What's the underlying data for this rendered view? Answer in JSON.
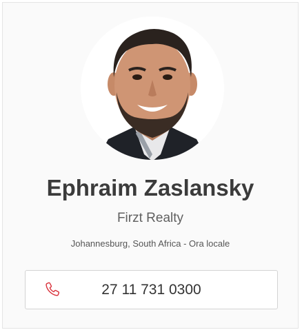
{
  "agent": {
    "name": "Ephraim Zaslansky",
    "company": "Firzt Realty",
    "location": "Johannesburg, South Africa - Ora locale",
    "phone": "27 11 731 0300"
  },
  "icons": {
    "phone": "phone-icon"
  },
  "colors": {
    "accent": "#d9303a",
    "name_text": "#3b3b3b",
    "card_bg": "#fafafa"
  }
}
